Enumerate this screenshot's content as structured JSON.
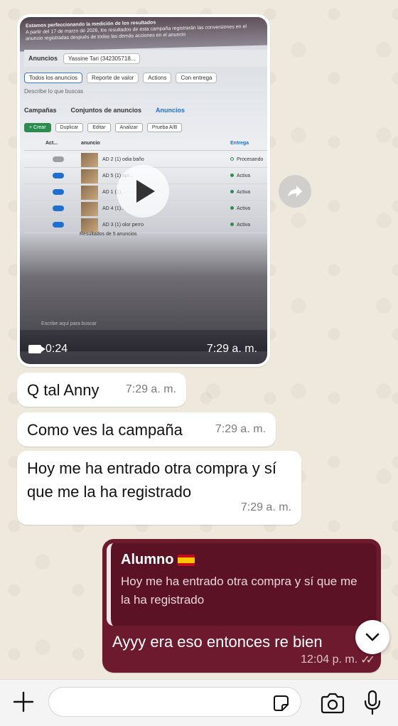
{
  "video_message": {
    "duration": "0:24",
    "time": "7:29 a. m.",
    "screen": {
      "banner_title": "Estamos perfeccionando la medición de los resultados",
      "banner_text": "A partir del 17 de marzo de 2026, los resultados de esta campaña registrarán las conversiones en el anuncio registradas después de todas las demás acciones en el anuncio",
      "section": "Anuncios",
      "account": "Yassine Tari (342305718...",
      "filter_all": "Todos los anuncios",
      "filter_value": "Reporte de valor",
      "filter_actions": "Actions",
      "filter_delivery": "Con entrega",
      "search_placeholder": "Describe lo que buscas",
      "tab_campaigns": "Campañas",
      "tab_adsets": "Conjuntos de anuncios",
      "tab_ads": "Anuncios",
      "btn_create": "+ Crear",
      "btn_duplicate": "Duplicar",
      "btn_edit": "Editar",
      "btn_analyze": "Analizar",
      "btn_ab": "Prueba A/B",
      "col_act": "Act...",
      "col_ad": "anuncio",
      "col_delivery": "Entrega",
      "rows": [
        {
          "name": "AD 2 (1) odia baño",
          "status": "Procesando",
          "on": false
        },
        {
          "name": "AD 5 (1) apr...",
          "status": "Activa",
          "on": true
        },
        {
          "name": "AD 1 (1)...",
          "status": "Activa",
          "on": true
        },
        {
          "name": "AD 4 (1)...",
          "status": "Activa",
          "on": true
        },
        {
          "name": "AD 3 (1) olor perro",
          "status": "Activa",
          "on": true
        }
      ],
      "results": "Resultados de 5 anuncios",
      "taskbar_search": "Escribe aquí para buscar"
    }
  },
  "messages": [
    {
      "text": "Q tal Anny",
      "time": "7:29 a. m."
    },
    {
      "text": "Como ves la campaña",
      "time": "7:29 a. m."
    },
    {
      "text": "Hoy me ha entrado otra compra y sí que me la ha registrado",
      "time": "7:29 a. m."
    }
  ],
  "reply": {
    "quote_author": "Alumno",
    "quote_text": "Hoy me ha entrado otra compra y sí que me la ha registrado",
    "text": "Ayyy era eso entonces re bien",
    "time": "12:04 p. m.",
    "ticks": "✓✓"
  },
  "input": {
    "placeholder": ""
  },
  "colors": {
    "outgoing_bubble": "#6e1a2e",
    "incoming_bubble": "#ffffff",
    "wallpaper": "#efe8dc"
  }
}
